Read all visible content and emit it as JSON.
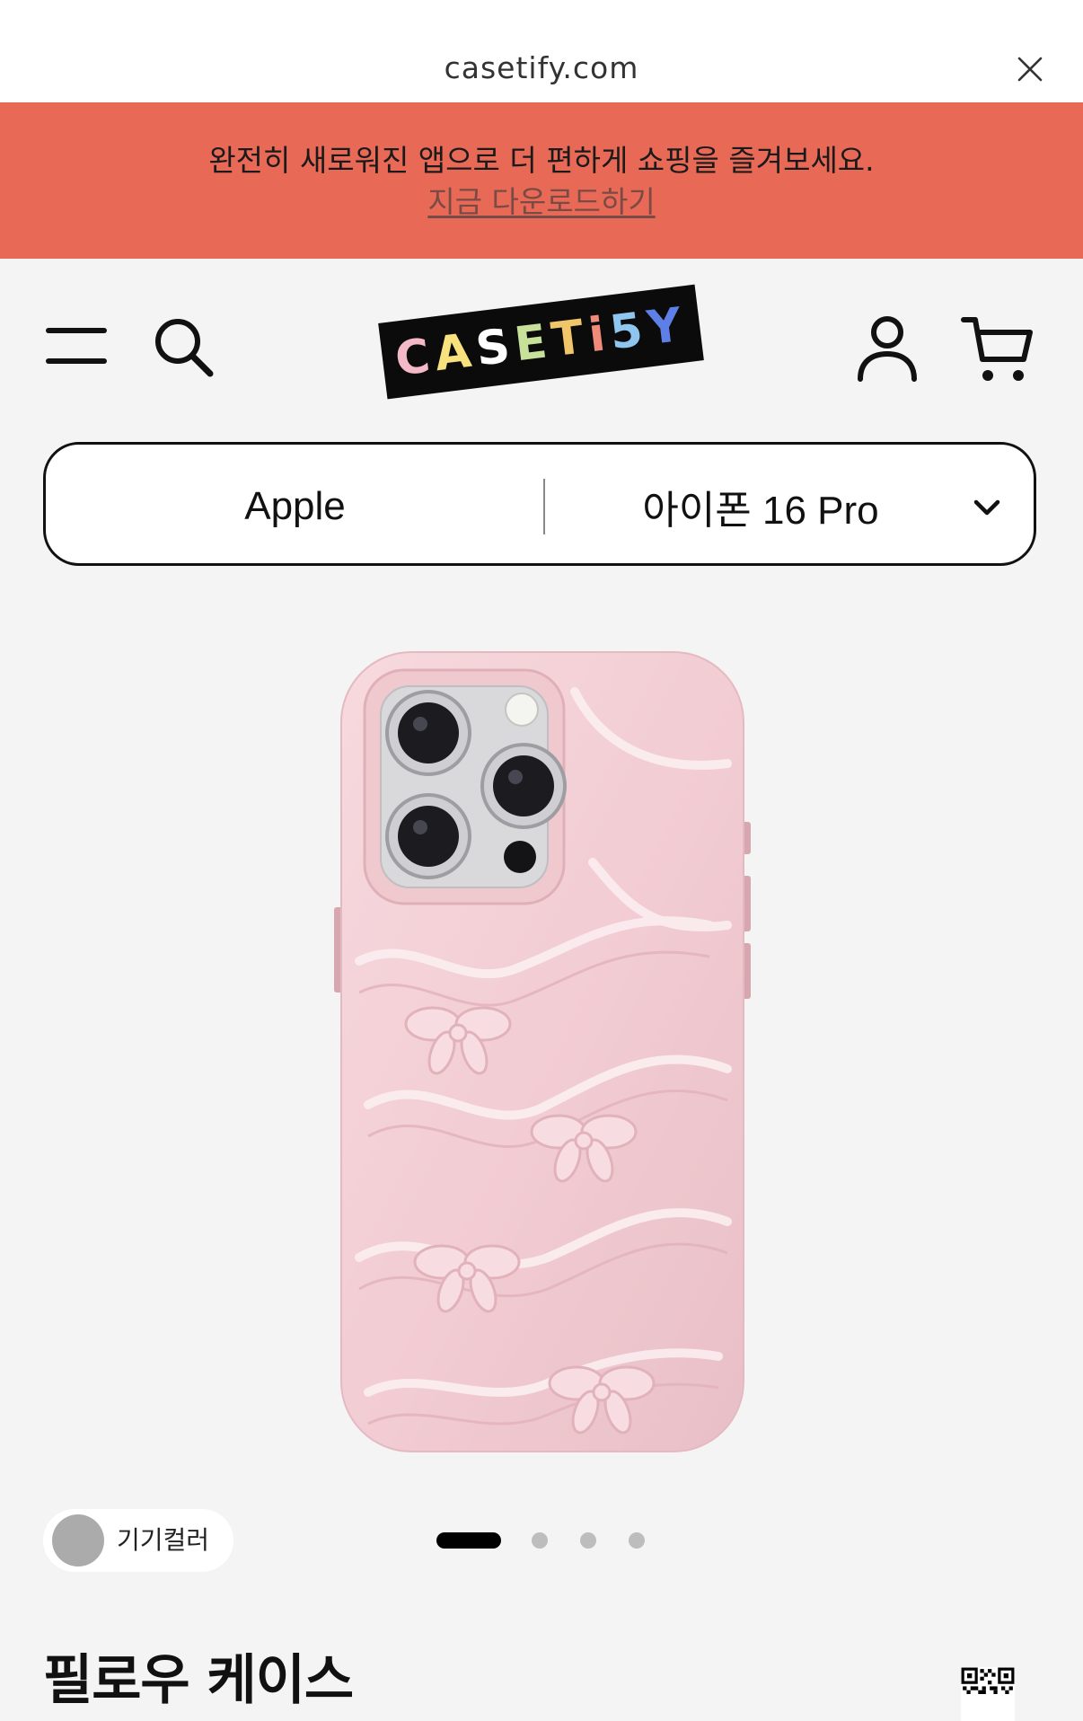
{
  "browser": {
    "url": "casetify.com"
  },
  "banner": {
    "message": "완전히 새로워진 앱으로 더 편하게 쇼핑을 즐겨보세요.",
    "link": "지금 다운로드하기",
    "color": "#e96957"
  },
  "header": {
    "logo_letters": [
      "C",
      "A",
      "S",
      "E",
      "T",
      "i",
      "5",
      "Y"
    ],
    "logo_colors": [
      "#f3b9c7",
      "#f7e27d",
      "#ffffff",
      "#c7e09a",
      "#f1c56a",
      "#f08a7a",
      "#8ec6ef",
      "#5e7fe6"
    ],
    "icons": [
      "menu-icon",
      "search-icon",
      "account-icon",
      "cart-icon"
    ]
  },
  "device_selector": {
    "brand": "Apple",
    "model": "아이폰 16 Pro"
  },
  "gallery": {
    "total_slides": 4,
    "active_slide": 1
  },
  "device_color": {
    "label": "기기컬러",
    "swatch_color": "#ababab"
  },
  "product": {
    "title": "필로우 케이스",
    "case_color": "#f2cdd3"
  }
}
